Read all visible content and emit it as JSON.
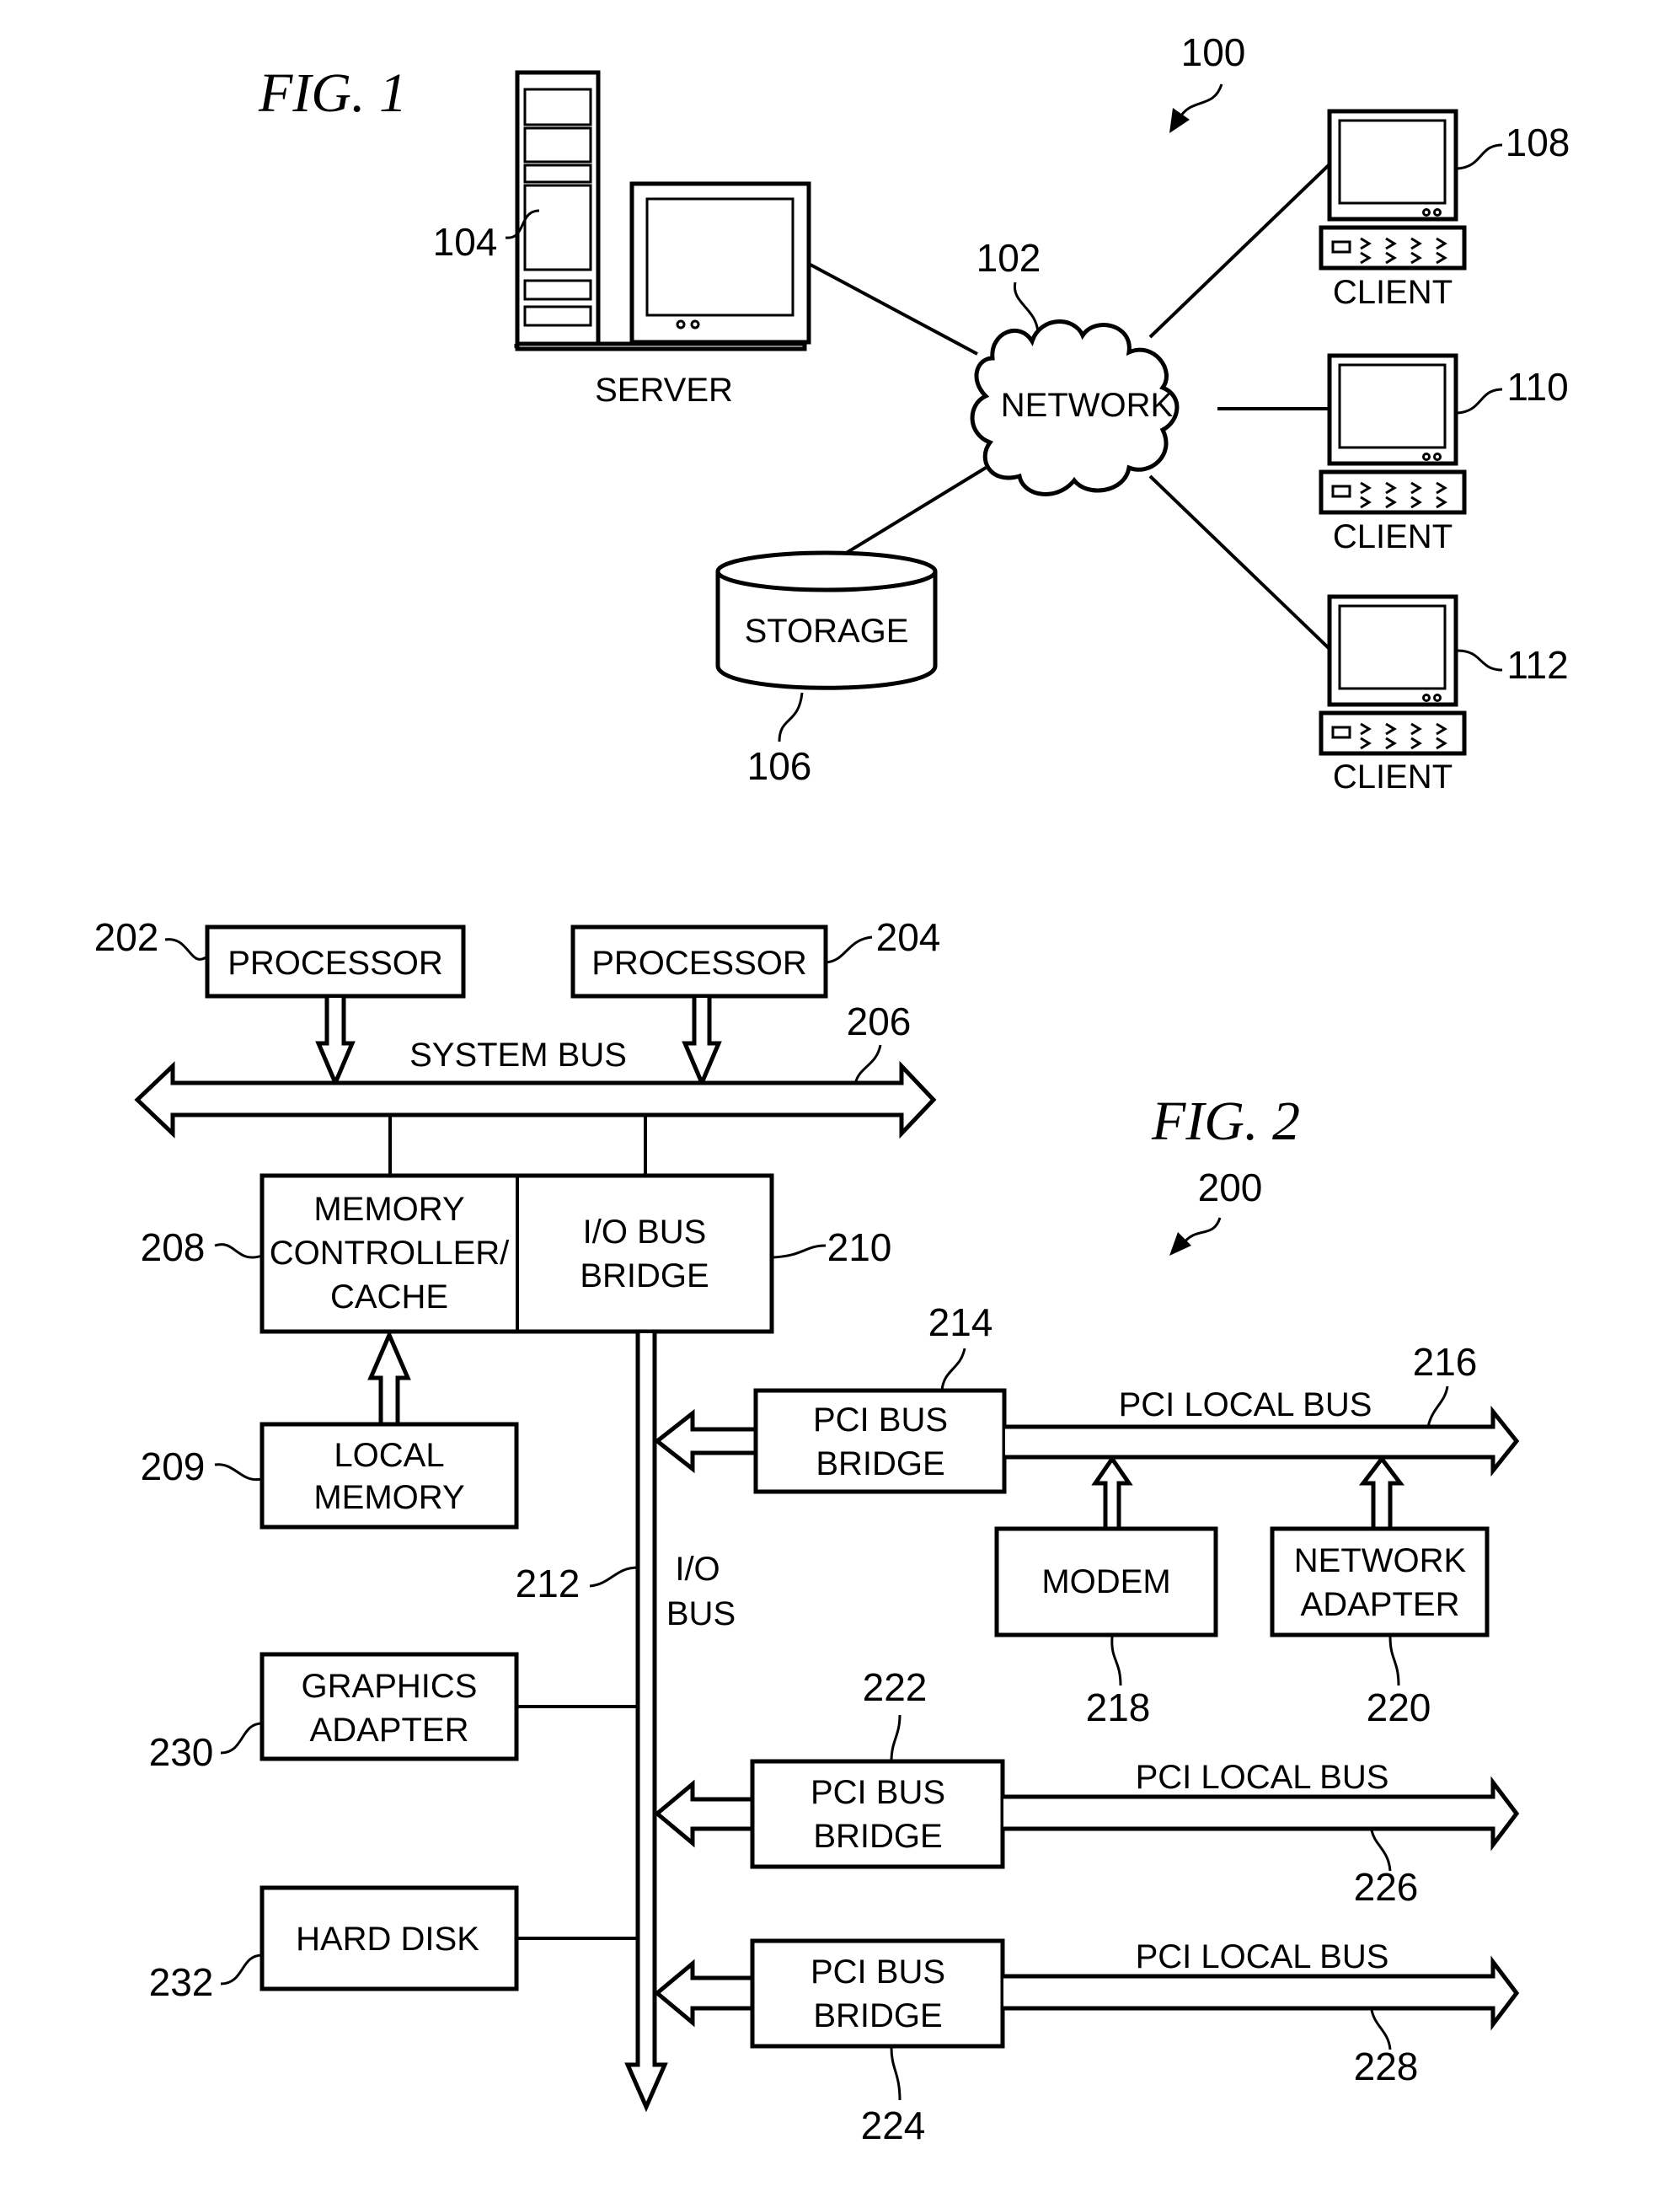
{
  "fig1": {
    "title": "FIG. 1",
    "ref_system": "100",
    "network": {
      "label": "NETWORK",
      "ref": "102"
    },
    "server": {
      "label": "SERVER",
      "ref": "104"
    },
    "storage": {
      "label": "STORAGE",
      "ref": "106"
    },
    "clients": [
      {
        "label": "CLIENT",
        "ref": "108"
      },
      {
        "label": "CLIENT",
        "ref": "110"
      },
      {
        "label": "CLIENT",
        "ref": "112"
      }
    ]
  },
  "fig2": {
    "title": "FIG. 2",
    "ref_system": "200",
    "processor_a": {
      "label": "PROCESSOR",
      "ref": "202"
    },
    "processor_b": {
      "label": "PROCESSOR",
      "ref": "204"
    },
    "system_bus": {
      "label": "SYSTEM BUS",
      "ref": "206"
    },
    "memory_controller": {
      "lines": [
        "MEMORY",
        "CONTROLLER/",
        "CACHE"
      ],
      "ref": "208"
    },
    "local_memory": {
      "lines": [
        "LOCAL",
        "MEMORY"
      ],
      "ref": "209"
    },
    "io_bridge": {
      "lines": [
        "I/O BUS",
        "BRIDGE"
      ],
      "ref": "210"
    },
    "io_bus": {
      "lines": [
        "I/O",
        "BUS"
      ],
      "ref": "212"
    },
    "pci_bridge_1": {
      "lines": [
        "PCI BUS",
        "BRIDGE"
      ],
      "ref": "214"
    },
    "pci_bus_1": {
      "label": "PCI LOCAL BUS",
      "ref": "216"
    },
    "modem": {
      "label": "MODEM",
      "ref": "218"
    },
    "network_adapter": {
      "lines": [
        "NETWORK",
        "ADAPTER"
      ],
      "ref": "220"
    },
    "pci_bridge_2": {
      "lines": [
        "PCI BUS",
        "BRIDGE"
      ],
      "ref": "222"
    },
    "pci_bus_2": {
      "label": "PCI LOCAL BUS",
      "ref": "226"
    },
    "pci_bridge_3": {
      "lines": [
        "PCI BUS",
        "BRIDGE"
      ],
      "ref": "224"
    },
    "pci_bus_3": {
      "label": "PCI LOCAL BUS",
      "ref": "228"
    },
    "graphics_adapter": {
      "lines": [
        "GRAPHICS",
        "ADAPTER"
      ],
      "ref": "230"
    },
    "hard_disk": {
      "label": "HARD DISK",
      "ref": "232"
    }
  }
}
